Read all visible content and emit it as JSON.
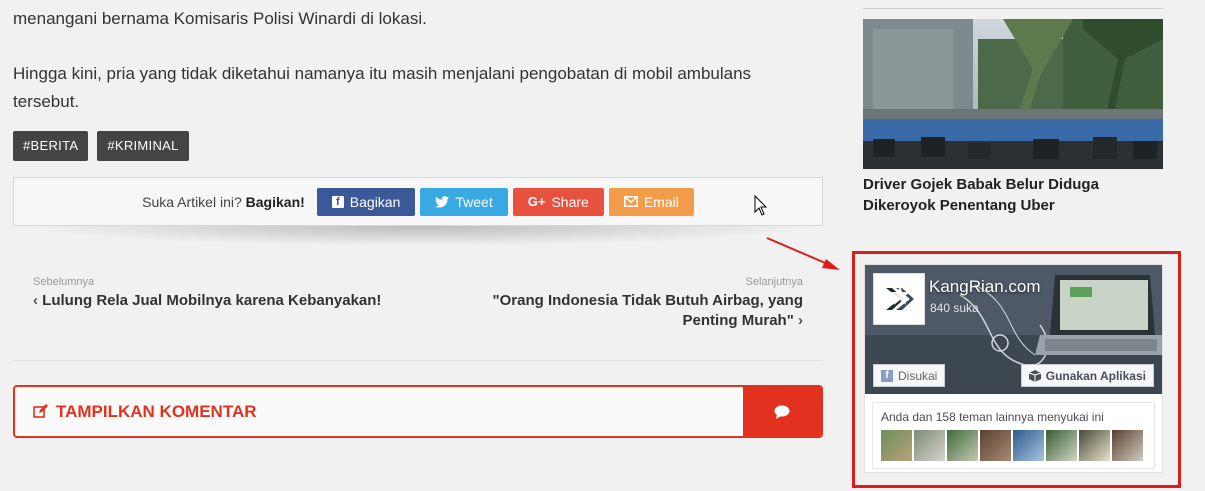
{
  "article": {
    "para1": "menangani bernama Komisaris Polisi Winardi di lokasi.",
    "para2": "Hingga kini, pria yang tidak diketahui namanya itu masih menjalani pengobatan di mobil ambulans tersebut.",
    "tags": [
      "#BERITA",
      "#KRIMINAL"
    ]
  },
  "share": {
    "prompt": "Suka Artikel ini? ",
    "prompt_bold": "Bagikan!",
    "facebook": "Bagikan",
    "twitter": "Tweet",
    "googleplus": "Share",
    "email": "Email",
    "googleplus_icon": "G+"
  },
  "nav": {
    "prev_label": "Sebelumnya",
    "prev_title": "Lulung Rela Jual Mobilnya karena Kebanyakan!",
    "next_label": "Selanjutnya",
    "next_title": "\"Orang Indonesia Tidak Butuh Airbag, yang Penting Murah\""
  },
  "comments": {
    "label": "TAMPILKAN KOMENTAR"
  },
  "sidebar": {
    "related_title": "Driver Gojek Babak Belur Diduga Dikeroyok Penentang Uber"
  },
  "fb_widget": {
    "page_name": "KangRian.com",
    "likes": "840 suka",
    "liked_button": "Disukai",
    "app_button": "Gunakan Aplikasi",
    "friends_text": "Anda dan 158 teman lainnya menyukai ini"
  },
  "colors": {
    "facebook": "#3b5998",
    "twitter": "#38a9e2",
    "googleplus": "#e9513f",
    "email": "#f39c4a",
    "accent_red": "#e2321f",
    "annotation_red": "#e01b1b"
  },
  "icons": [
    "facebook-icon",
    "twitter-bird-icon",
    "google-plus-icon",
    "envelope-icon",
    "chevron-left-icon",
    "chevron-right-icon",
    "edit-icon",
    "comment-bubble-icon",
    "facebook-square-icon",
    "app-cube-icon",
    "mouse-cursor-icon"
  ]
}
